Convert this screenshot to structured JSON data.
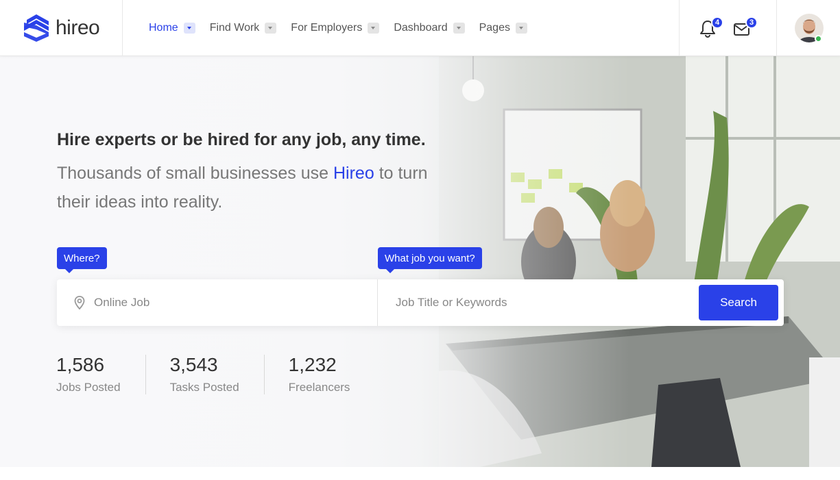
{
  "brand": {
    "name": "hireo",
    "accent": "#2a41e8"
  },
  "nav": {
    "items": [
      {
        "label": "Home",
        "active": true
      },
      {
        "label": "Find Work",
        "active": false
      },
      {
        "label": "For Employers",
        "active": false
      },
      {
        "label": "Dashboard",
        "active": false
      },
      {
        "label": "Pages",
        "active": false
      }
    ]
  },
  "header_icons": {
    "notifications": {
      "icon": "bell-icon",
      "count": "4"
    },
    "messages": {
      "icon": "envelope-icon",
      "count": "3"
    },
    "user": {
      "icon": "avatar",
      "status": "online",
      "status_color": "#38b653"
    }
  },
  "hero": {
    "headline": "Hire experts or be hired for any job, any time.",
    "subline_before": "Thousands of small businesses use ",
    "subline_brand": "Hireo",
    "subline_after": " to turn their ideas into reality."
  },
  "search": {
    "where_tag": "Where?",
    "what_tag": "What job you want?",
    "where_placeholder": "Online Job",
    "what_placeholder": "Job Title or Keywords",
    "button_label": "Search"
  },
  "stats": [
    {
      "value": "1,586",
      "label": "Jobs Posted"
    },
    {
      "value": "3,543",
      "label": "Tasks Posted"
    },
    {
      "value": "1,232",
      "label": "Freelancers"
    }
  ]
}
